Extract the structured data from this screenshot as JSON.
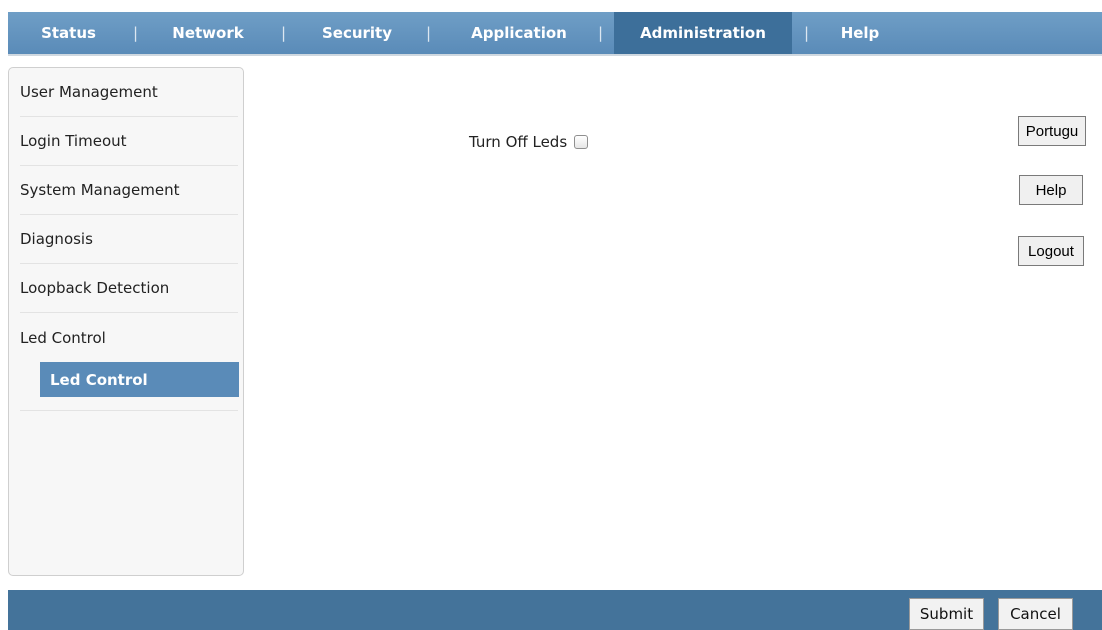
{
  "nav": {
    "tabs": [
      {
        "label": "Status"
      },
      {
        "label": "Network"
      },
      {
        "label": "Security"
      },
      {
        "label": "Application"
      },
      {
        "label": "Administration"
      },
      {
        "label": "Help"
      }
    ],
    "separator": "|",
    "active": "Administration"
  },
  "sidebar": {
    "items": [
      {
        "label": "User Management"
      },
      {
        "label": "Login Timeout"
      },
      {
        "label": "System Management"
      },
      {
        "label": "Diagnosis"
      },
      {
        "label": "Loopback Detection"
      },
      {
        "label": "Led Control"
      }
    ],
    "sub_item": {
      "label": "Led Control"
    }
  },
  "main": {
    "led_label": "Turn Off Leds",
    "led_checked": false
  },
  "side_buttons": {
    "language": "Portugu",
    "help": "Help",
    "logout": "Logout"
  },
  "footer": {
    "submit": "Submit",
    "cancel": "Cancel"
  },
  "colors": {
    "nav_bg": "#5a8bb8",
    "nav_active": "#3d6f9a",
    "footer_bg": "#44739a",
    "selected_item": "#5a8bb8"
  }
}
